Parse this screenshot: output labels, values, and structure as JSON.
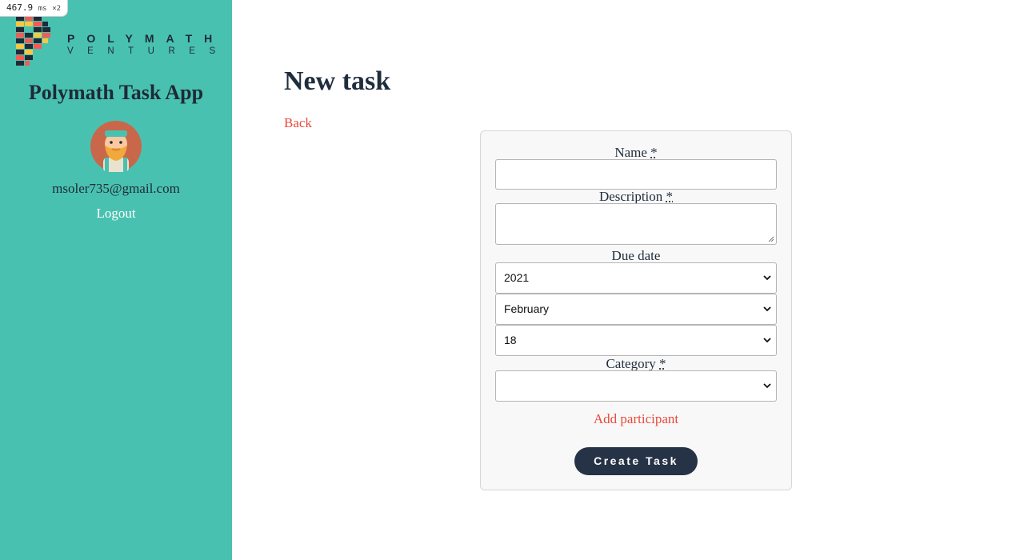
{
  "timer": {
    "value": "467.9",
    "unit": "ms",
    "multiplier": "×2"
  },
  "sidebar": {
    "logo": {
      "icon": "polymath-p-logo-icon",
      "line1": "POLYMATH",
      "line2": "VENTURES"
    },
    "app_title": "Polymath Task App",
    "avatar_icon": "bearded-man-avatar-icon",
    "email": "msoler735@gmail.com",
    "logout_label": "Logout"
  },
  "main": {
    "title": "New task",
    "back_label": "Back"
  },
  "form": {
    "name_label": "Name",
    "name_value": "",
    "description_label": "Description",
    "description_value": "",
    "due_date_label": "Due date",
    "year": "2021",
    "month": "February",
    "day": "18",
    "category_label": "Category",
    "category_value": "",
    "required_marker": "*",
    "add_participant_label": "Add participant",
    "submit_label": "Create Task"
  },
  "colors": {
    "sidebar_bg": "#49c1b0",
    "link": "#e64a3b",
    "button_bg": "#263246",
    "heading": "#1f2d3d"
  }
}
